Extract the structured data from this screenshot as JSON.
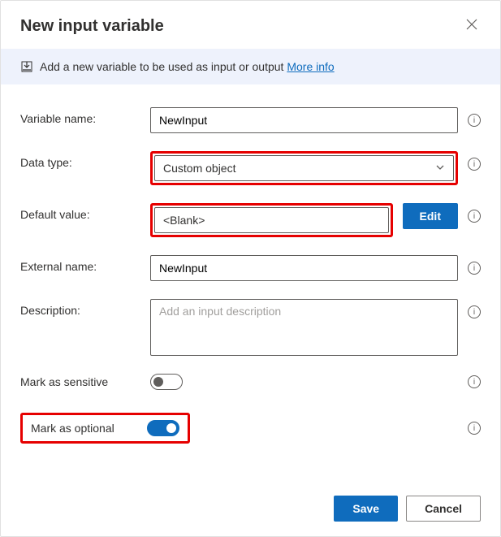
{
  "title": "New input variable",
  "banner": {
    "text": "Add a new variable to be used as input or output ",
    "linkText": "More info"
  },
  "fields": {
    "variableName": {
      "label": "Variable name:",
      "value": "NewInput"
    },
    "dataType": {
      "label": "Data type:",
      "value": "Custom object"
    },
    "defaultValue": {
      "label": "Default value:",
      "value": "<Blank>",
      "editLabel": "Edit"
    },
    "externalName": {
      "label": "External name:",
      "value": "NewInput"
    },
    "description": {
      "label": "Description:",
      "placeholder": "Add an input description"
    },
    "markSensitive": {
      "label": "Mark as sensitive"
    },
    "markOptional": {
      "label": "Mark as optional"
    }
  },
  "footer": {
    "save": "Save",
    "cancel": "Cancel"
  },
  "infoGlyph": "i"
}
